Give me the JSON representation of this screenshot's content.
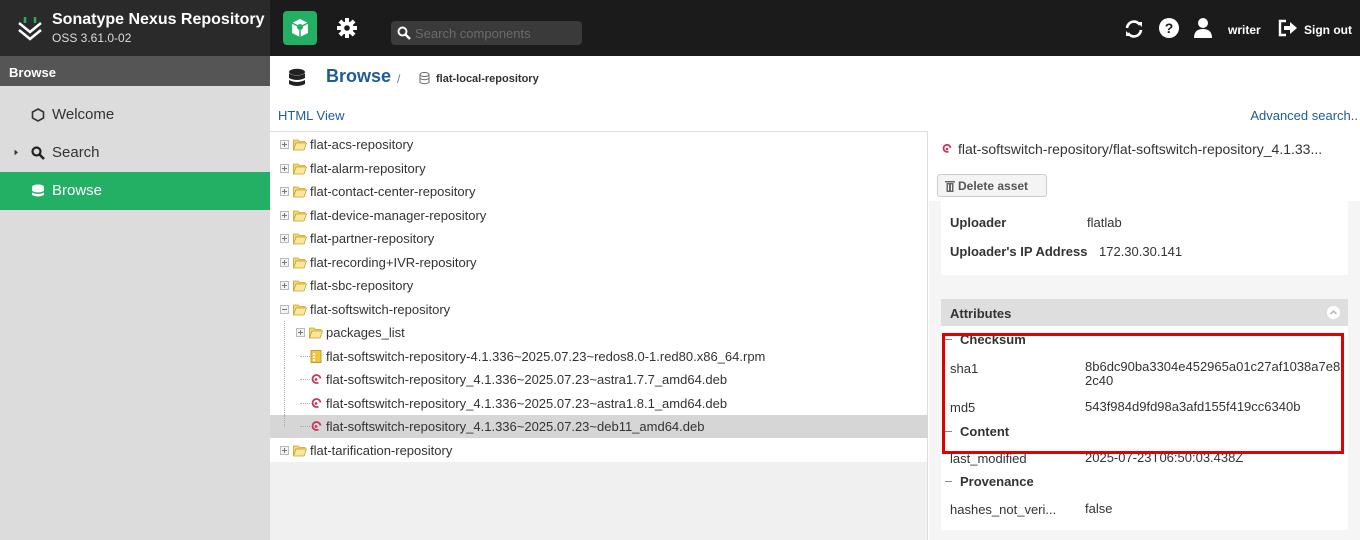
{
  "topbar": {
    "brand_name": "Sonatype Nexus Repository",
    "brand_version": "OSS 3.61.0-02",
    "search_placeholder": "Search components",
    "user_name": "writer",
    "signout_label": "Sign out"
  },
  "leftnav": {
    "header": "Browse",
    "items": [
      {
        "label": "Welcome",
        "icon": "hexagon-icon"
      },
      {
        "label": "Search",
        "icon": "search-icon"
      },
      {
        "label": "Browse",
        "icon": "database-icon",
        "active": true
      }
    ]
  },
  "center": {
    "breadcrumb_title": "Browse",
    "breadcrumb_sep": "/",
    "breadcrumb_repo": "flat-local-repository",
    "html_view": "HTML View",
    "advanced_search": "Advanced search..",
    "tree": [
      {
        "label": "flat-acs-repository",
        "type": "folder"
      },
      {
        "label": "flat-alarm-repository",
        "type": "folder"
      },
      {
        "label": "flat-contact-center-repository",
        "type": "folder"
      },
      {
        "label": "flat-device-manager-repository",
        "type": "folder"
      },
      {
        "label": "flat-partner-repository",
        "type": "folder"
      },
      {
        "label": "flat-recording+IVR-repository",
        "type": "folder"
      },
      {
        "label": "flat-sbc-repository",
        "type": "folder"
      },
      {
        "label": "flat-softswitch-repository",
        "type": "folder",
        "expanded": true
      },
      {
        "label": "packages_list",
        "type": "folder"
      },
      {
        "label": "flat-softswitch-repository-4.1.336~2025.07.23~redos8.0-1.red80.x86_64.rpm",
        "type": "rpm"
      },
      {
        "label": "flat-softswitch-repository_4.1.336~2025.07.23~astra1.7.7_amd64.deb",
        "type": "deb"
      },
      {
        "label": "flat-softswitch-repository_4.1.336~2025.07.23~astra1.8.1_amd64.deb",
        "type": "deb"
      },
      {
        "label": "flat-softswitch-repository_4.1.336~2025.07.23~deb11_amd64.deb",
        "type": "deb",
        "selected": true
      },
      {
        "label": "flat-tarification-repository",
        "type": "folder"
      }
    ]
  },
  "details": {
    "title": "flat-softswitch-repository/flat-softswitch-repository_4.1.33...",
    "delete_label": "Delete asset",
    "uploader_label": "Uploader",
    "uploader_value": "flatlab",
    "uploader_ip_label": "Uploader's IP Address",
    "uploader_ip_value": "172.30.30.141",
    "attributes_header": "Attributes",
    "groups": {
      "checksum": "Checksum",
      "content": "Content",
      "provenance": "Provenance"
    },
    "sha1_label": "sha1",
    "sha1_value": "8b6dc90ba3304e452965a01c27af1038a7e82c40",
    "md5_label": "md5",
    "md5_value": "543f984d9fd98a3afd155f419cc6340b",
    "last_modified_label": "last_modified",
    "last_modified_value": "2025-07-23T06:50:03.438Z",
    "hashes_label": "hashes_not_veri...",
    "hashes_value": "false"
  },
  "colors": {
    "accent_green": "#24b064",
    "link_blue": "#1e5b94",
    "highlight_red": "#e00000",
    "topbar_bg": "#1b1b1b"
  }
}
